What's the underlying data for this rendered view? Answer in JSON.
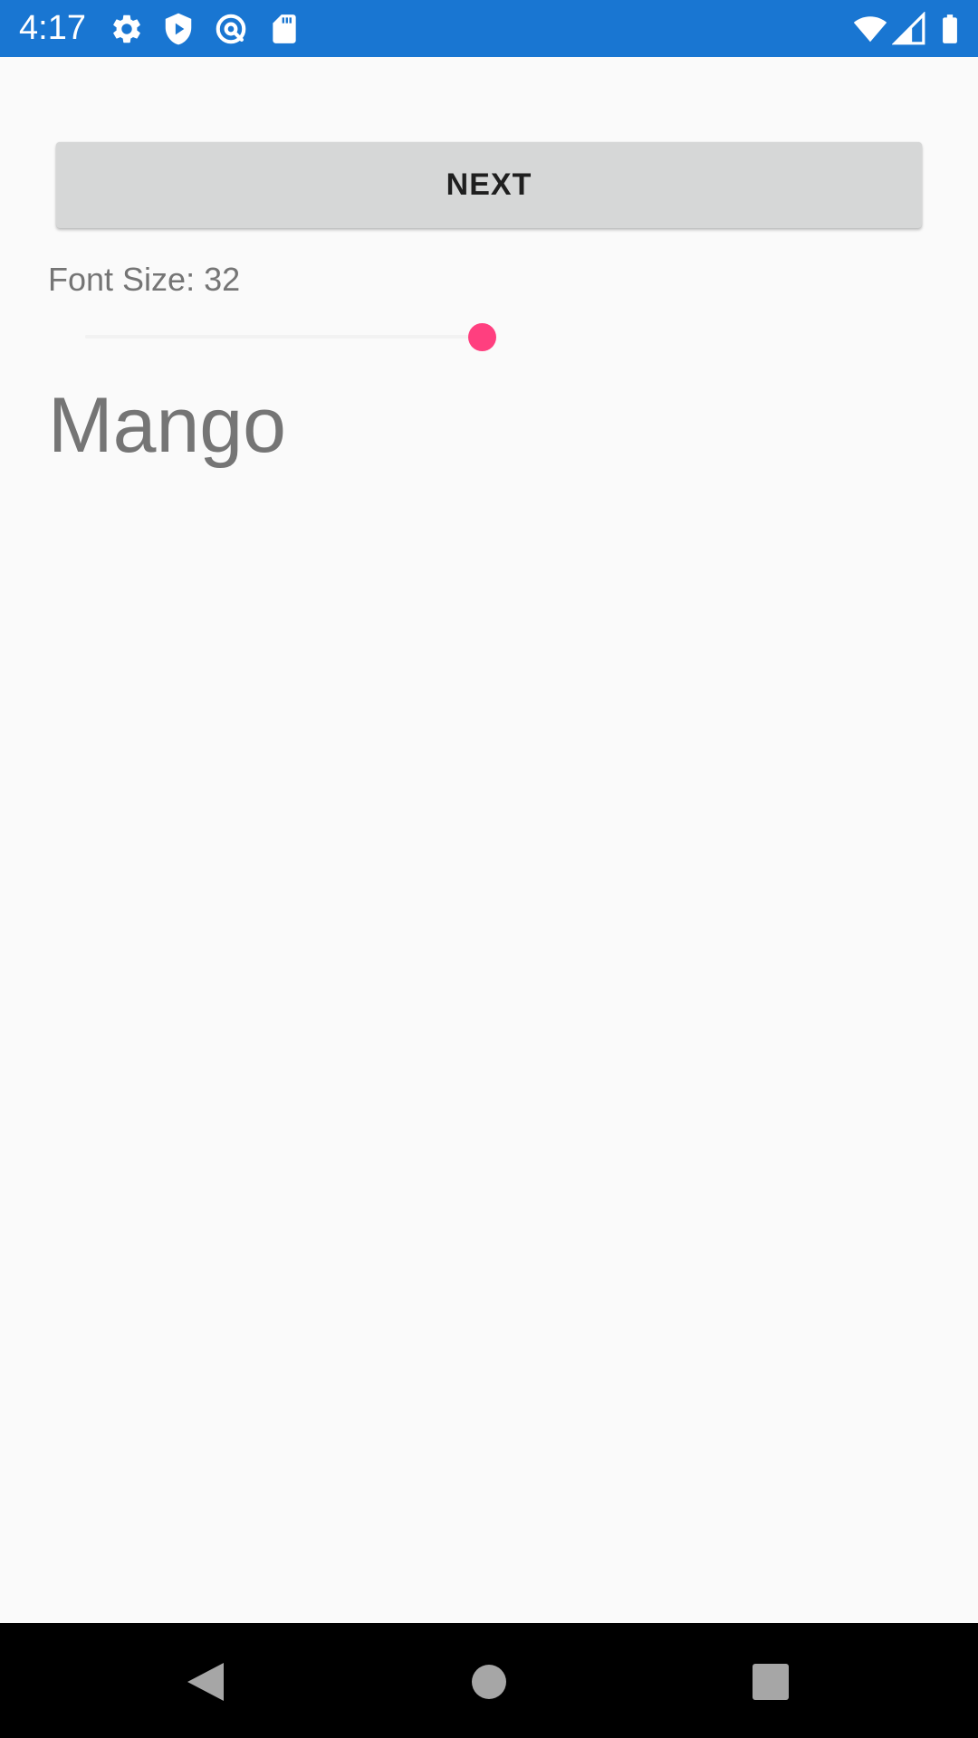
{
  "status_bar": {
    "time": "4:17",
    "background_color": "#1976d2",
    "left_icons": [
      "settings-icon",
      "play-protect-icon",
      "vpn-key-icon",
      "sd-card-icon"
    ],
    "right_icons": [
      "wifi-icon",
      "cell-signal-icon",
      "battery-icon"
    ]
  },
  "main": {
    "next_button_label": "NEXT",
    "font_size_label": "Font Size: 32",
    "slider": {
      "value_fraction": 1.0,
      "accent_color": "#ff3f7f"
    },
    "preview_text": "Mango"
  },
  "nav_bar": {
    "buttons": [
      "back-icon",
      "home-icon",
      "recents-icon"
    ]
  }
}
